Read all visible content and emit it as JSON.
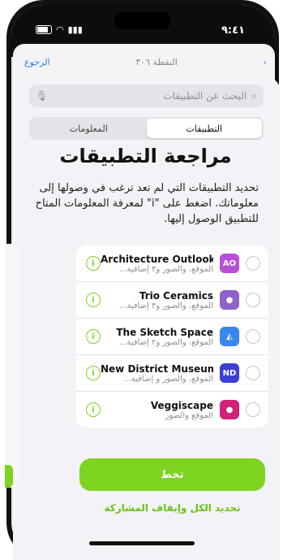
{
  "status": {
    "time": "٩:٤١"
  },
  "background": {
    "left_link": "الرجوع",
    "center_text": "النقطة ٣٠٦"
  },
  "search": {
    "placeholder": "البحث عن التطبيقات"
  },
  "segment": {
    "apps_label": "التطبيقات",
    "info_label": "المعلومات",
    "selected": "apps"
  },
  "title": "مراجعة التطبيقات",
  "description": "تحديد التطبيقات التي لم تعد ترغب في وصولها إلى معلوماتك. اضغط على \"i\" لمعرفة المعلومات المتاح للتطبيق الوصول إليها.",
  "apps": [
    {
      "name": "Architecture Outlook",
      "detail": "الموقع، والصور و٣ إضافية...",
      "icon": "AO-icon",
      "color": "#b84fd6",
      "glyph": "AO"
    },
    {
      "name": "Trio Ceramics",
      "detail": "الموقع، والصور و٣ إضافية...",
      "icon": "ceramics-icon",
      "color": "#8e62c9",
      "glyph": "●"
    },
    {
      "name": "The Sketch Space",
      "detail": "الموقع، والصور و٢ إضافية...",
      "icon": "sketch-icon",
      "color": "#3a86f0",
      "glyph": "◭"
    },
    {
      "name": "New District Museum",
      "detail": "الموقع، والصور و إضافية...",
      "icon": "museum-icon",
      "color": "#3b40d6",
      "glyph": "ND"
    },
    {
      "name": "Veggiscape",
      "detail": "الموقع والصور",
      "icon": "veggiscape-icon",
      "color": "#d1217a",
      "glyph": "●"
    }
  ],
  "actions": {
    "primary_label": "تخط",
    "secondary_label": "تحديد الكل وإيقاف المشاركة"
  },
  "colors": {
    "accent": "#7ed321"
  }
}
